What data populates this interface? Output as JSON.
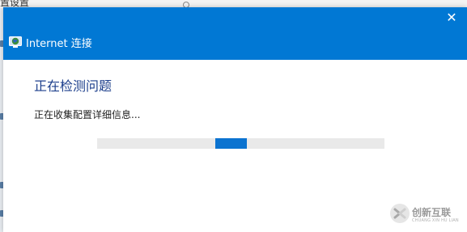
{
  "background_window": {
    "title_fragment": "置设置"
  },
  "dialog": {
    "title": "Internet 连接",
    "close_glyph": "✕",
    "heading": "正在检测问题",
    "status_text": "正在收集配置详细信息...",
    "progress": {
      "mode": "indeterminate",
      "chunk_start_fraction": 0.41,
      "chunk_width_fraction": 0.11
    },
    "icons": {
      "title": "network-globe-icon",
      "close": "close-icon"
    }
  },
  "watermark": {
    "text": "创新互联",
    "subtext": "CHUANG XIN HU LIAN"
  },
  "colors": {
    "titlebar": "#0178d4",
    "heading": "#1d3f8c",
    "progress_track": "#e9e9e9",
    "progress_chunk": "#0b73d0"
  }
}
